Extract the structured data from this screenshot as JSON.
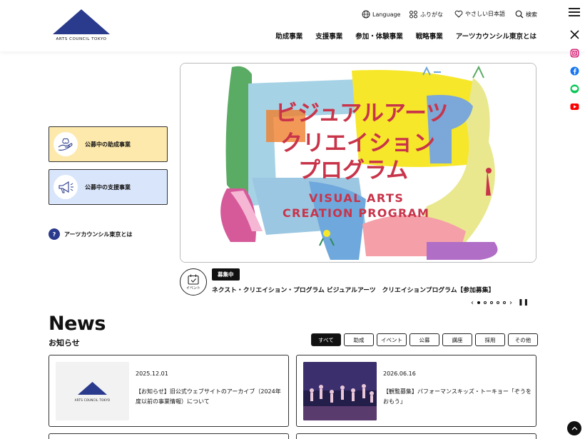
{
  "header": {
    "logo_text": "ARTS COUNCIL TOKYO",
    "utility": {
      "language": "Language",
      "furigana": "ふりがな",
      "easy_japanese": "やさしい日本語",
      "search": "検索"
    },
    "nav": [
      "助成事業",
      "支援事業",
      "参加・体験事業",
      "戦略事業",
      "アーツカウンシル東京とは"
    ]
  },
  "social": [
    "x-icon",
    "instagram-icon",
    "facebook-icon",
    "line-icon",
    "youtube-icon"
  ],
  "sidebar": {
    "cards": [
      {
        "label": "公募中の助成事業",
        "bg": "#fde9ac"
      },
      {
        "label": "公募中の支援事業",
        "bg": "#d9e5fb"
      }
    ],
    "about_link": "アーツカウンシル東京とは",
    "about_icon_text": "?"
  },
  "hero": {
    "title_jp": [
      "ビジュアルアーツ",
      "クリエイション",
      "プログラム"
    ],
    "title_en": [
      "VISUAL ARTS",
      "CREATION PROGRAM"
    ],
    "badge": "募集中",
    "event_icon_label": "イベント",
    "caption": "ネクスト・クリエイション・プログラム ビジュアルアーツ　クリエイションプログラム【参加募集】",
    "slides_count": 5,
    "active_slide": 1
  },
  "news": {
    "title": "News",
    "subtitle": "お知らせ",
    "filters": [
      "すべて",
      "助成",
      "イベント",
      "公募",
      "講座",
      "採用",
      "その他"
    ],
    "active_filter": "すべて",
    "items": [
      {
        "date": "2025.12.01",
        "text": "【お知らせ】旧公式ウェブサイトのアーカイブ（2024年度以前の事業情報）について",
        "thumb_logo": "ARTS COUNCIL TOKYO"
      },
      {
        "date": "2026.06.16",
        "text": "【観覧募集】パフォーマンスキッズ・トーキョー「ぞうをおもう」"
      }
    ]
  },
  "colors": {
    "brand": "#2a3a8c",
    "accent_yellow": "#fde9ac",
    "accent_blue": "#d9e5fb"
  }
}
